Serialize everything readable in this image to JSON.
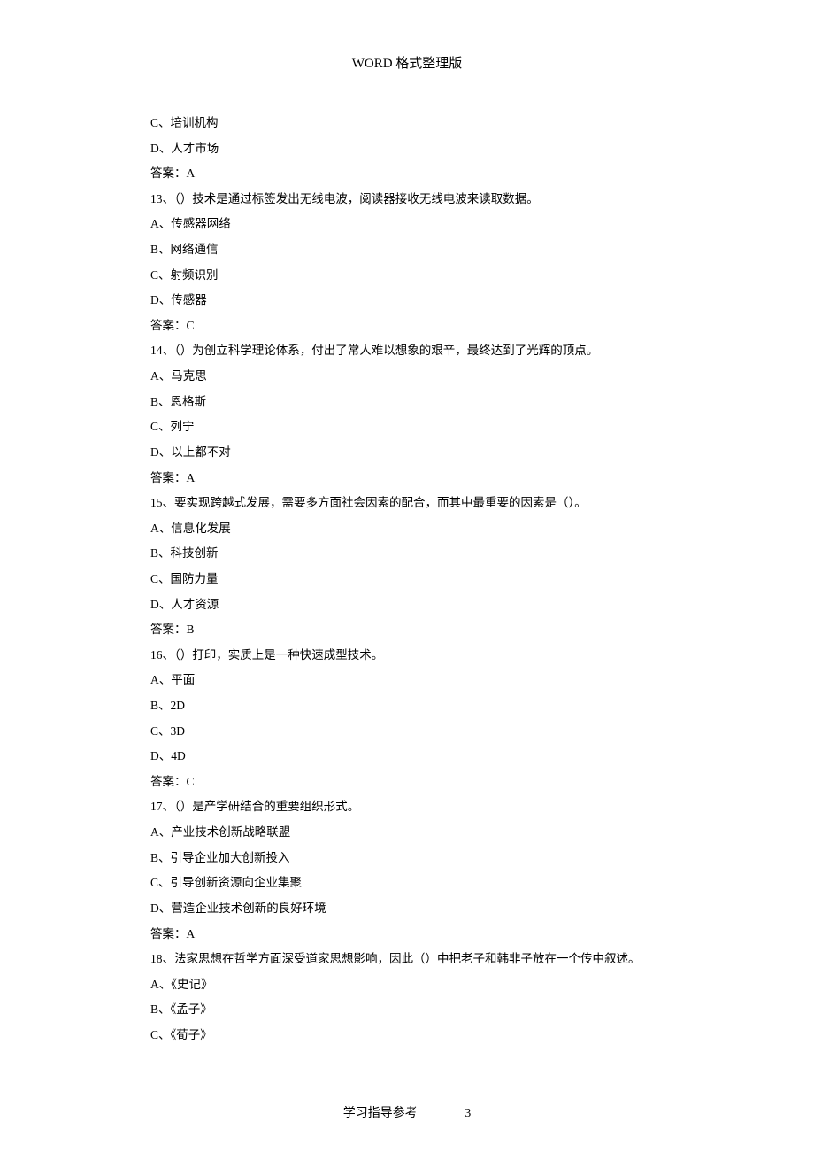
{
  "header": "WORD 格式整理版",
  "footer": {
    "label": "学习指导参考",
    "page": "3"
  },
  "lines": [
    "C、培训机构",
    "D、人才市场",
    "答案：A",
    "13、（）技术是通过标签发出无线电波，阅读器接收无线电波来读取数据。",
    "A、传感器网络",
    "B、网络通信",
    "C、射频识别",
    "D、传感器",
    "答案：C",
    "14、（）为创立科学理论体系，付出了常人难以想象的艰辛，最终达到了光辉的顶点。",
    "A、马克思",
    "B、恩格斯",
    "C、列宁",
    "D、以上都不对",
    "答案：A",
    "15、要实现跨越式发展，需要多方面社会因素的配合，而其中最重要的因素是（）。",
    "A、信息化发展",
    "B、科技创新",
    "C、国防力量",
    "D、人才资源",
    "答案：B",
    "16、（）打印，实质上是一种快速成型技术。",
    "A、平面",
    "B、2D",
    "C、3D",
    "D、4D",
    "答案：C",
    "17、（）是产学研结合的重要组织形式。",
    "A、产业技术创新战略联盟",
    "B、引导企业加大创新投入",
    "C、引导创新资源向企业集聚",
    "D、营造企业技术创新的良好环境",
    "答案：A",
    "18、法家思想在哲学方面深受道家思想影响，因此（）中把老子和韩非子放在一个传中叙述。",
    "A、《史记》",
    "B、《孟子》",
    "C、《荀子》"
  ]
}
